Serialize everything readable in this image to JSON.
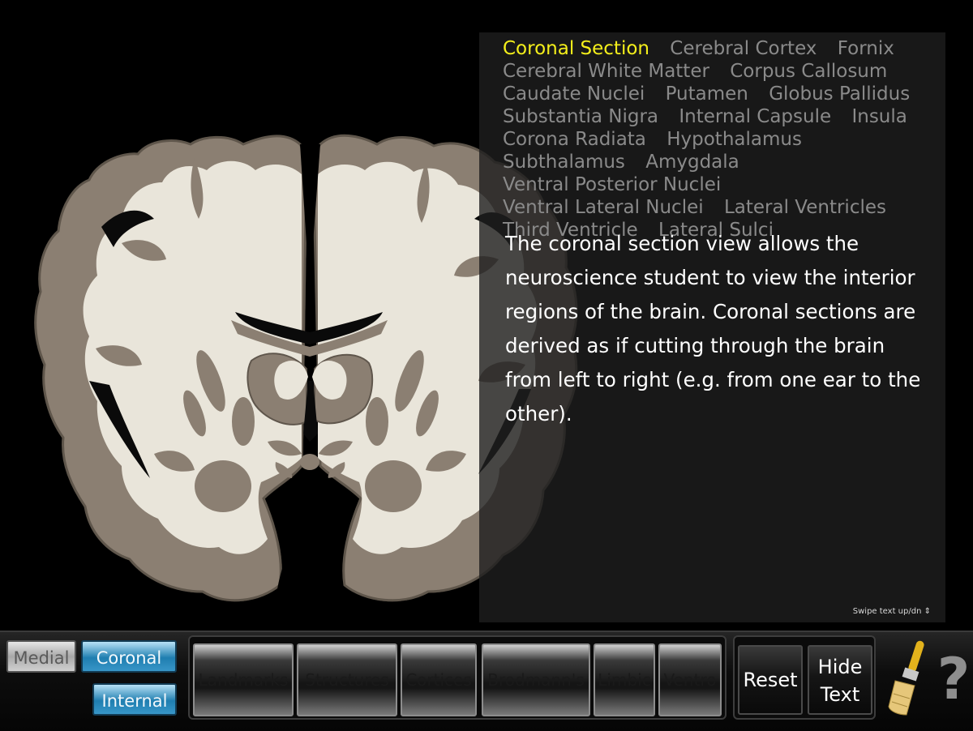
{
  "structures": {
    "items": [
      {
        "label": "Coronal Section",
        "active": true
      },
      {
        "label": "Cerebral Cortex",
        "active": false
      },
      {
        "label": "Fornix",
        "active": false
      },
      {
        "label": "Cerebral White Matter",
        "active": false
      },
      {
        "label": "Corpus Callosum",
        "active": false
      },
      {
        "label": "Caudate Nuclei",
        "active": false
      },
      {
        "label": "Putamen",
        "active": false
      },
      {
        "label": "Globus Pallidus",
        "active": false
      },
      {
        "label": "Substantia Nigra",
        "active": false
      },
      {
        "label": "Internal Capsule",
        "active": false
      },
      {
        "label": "Insula",
        "active": false
      },
      {
        "label": "Corona Radiata",
        "active": false
      },
      {
        "label": "Hypothalamus",
        "active": false
      },
      {
        "label": "Subthalamus",
        "active": false
      },
      {
        "label": "Amygdala",
        "active": false
      },
      {
        "label": "Ventral Posterior Nuclei",
        "active": false
      },
      {
        "label": "Ventral Lateral Nuclei",
        "active": false
      },
      {
        "label": "Lateral Ventricles",
        "active": false
      },
      {
        "label": "Third Ventricle",
        "active": false
      },
      {
        "label": "Lateral Sulci",
        "active": false
      }
    ],
    "active_color": "#f4ef1b",
    "inactive_color": "#8a8a8a"
  },
  "description": "The coronal section view allows the neuroscience student to view the interior regions of the brain. Coronal sections are derived as if cutting through the brain from left to right (e.g. from one ear to the other).",
  "swipe_hint": "Swipe text up/dn",
  "swipe_icon": "up-down-arrows-icon",
  "views": {
    "medial": {
      "label": "Medial",
      "selected": false
    },
    "coronal": {
      "label": "Coronal",
      "selected": true
    },
    "internal": {
      "label": "Internal",
      "selected": true
    }
  },
  "categories": [
    {
      "label": "Landmarks"
    },
    {
      "label": "Structures"
    },
    {
      "label": "Cortices"
    },
    {
      "label": "Brodmann's"
    },
    {
      "label": "Limbic"
    },
    {
      "label": "Ventro"
    }
  ],
  "actions": {
    "reset_label": "Reset",
    "hide_text_line1": "Hide",
    "hide_text_line2": "Text",
    "paint_icon": "paintbrush-icon",
    "help_symbol": "?"
  },
  "colors": {
    "gray_matter": "#8b7f72",
    "white_matter": "#e9e5da",
    "selected_button": "#1f7eb0"
  }
}
